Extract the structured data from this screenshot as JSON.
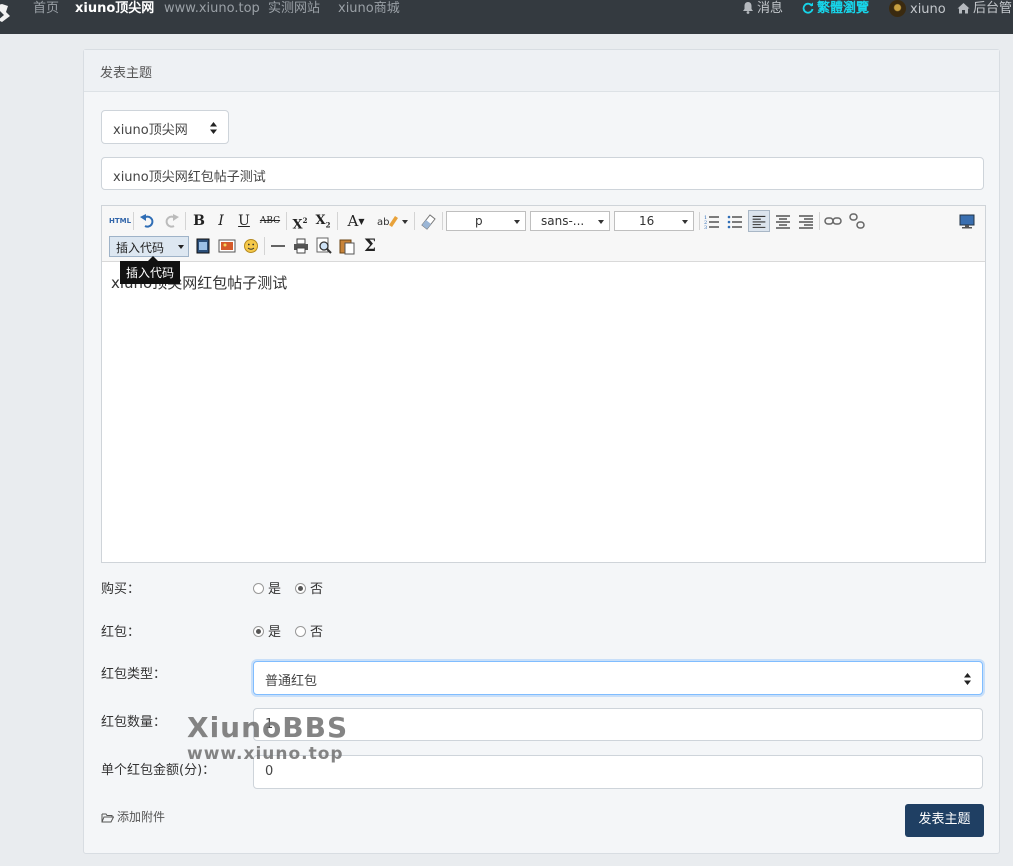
{
  "nav": {
    "home": "首页",
    "site": "xiuno顶尖网",
    "url": "www.xiuno.top",
    "test_site": "实测网站",
    "mall": "xiuno商城",
    "messages": "消息",
    "traditional": "繁體瀏覽",
    "username": "xiuno",
    "admin": "后台管"
  },
  "card": {
    "title": "发表主题"
  },
  "form": {
    "forum_select": "xiuno顶尖网",
    "subject": "xiuno顶尖网红包帖子测试",
    "editor": {
      "content": "xiuno顶尖网红包帖子测试",
      "paragraph": "p",
      "font": "sans-...",
      "size": "16",
      "code_combo": "插入代码",
      "tooltip": "插入代码"
    },
    "buy": {
      "label": "购买：",
      "yes": "是",
      "no": "否",
      "selected": "no"
    },
    "redpacket": {
      "label": "红包：",
      "yes": "是",
      "no": "否",
      "selected": "yes"
    },
    "redpacket_type": {
      "label": "红包类型：",
      "value": "普通红包"
    },
    "redpacket_count": {
      "label": "红包数量：",
      "value": "1"
    },
    "redpacket_amount": {
      "label": "单个红包金额(分)：",
      "value": "0"
    },
    "attach": "添加附件",
    "submit": "发表主题"
  },
  "watermark": {
    "line1": "XiunoBBS",
    "line2": "www.xiuno.top"
  },
  "colors": {
    "nav_bg": "#343a40",
    "accent_cyan": "#17d5ea",
    "submit_bg": "#1f3f63"
  }
}
